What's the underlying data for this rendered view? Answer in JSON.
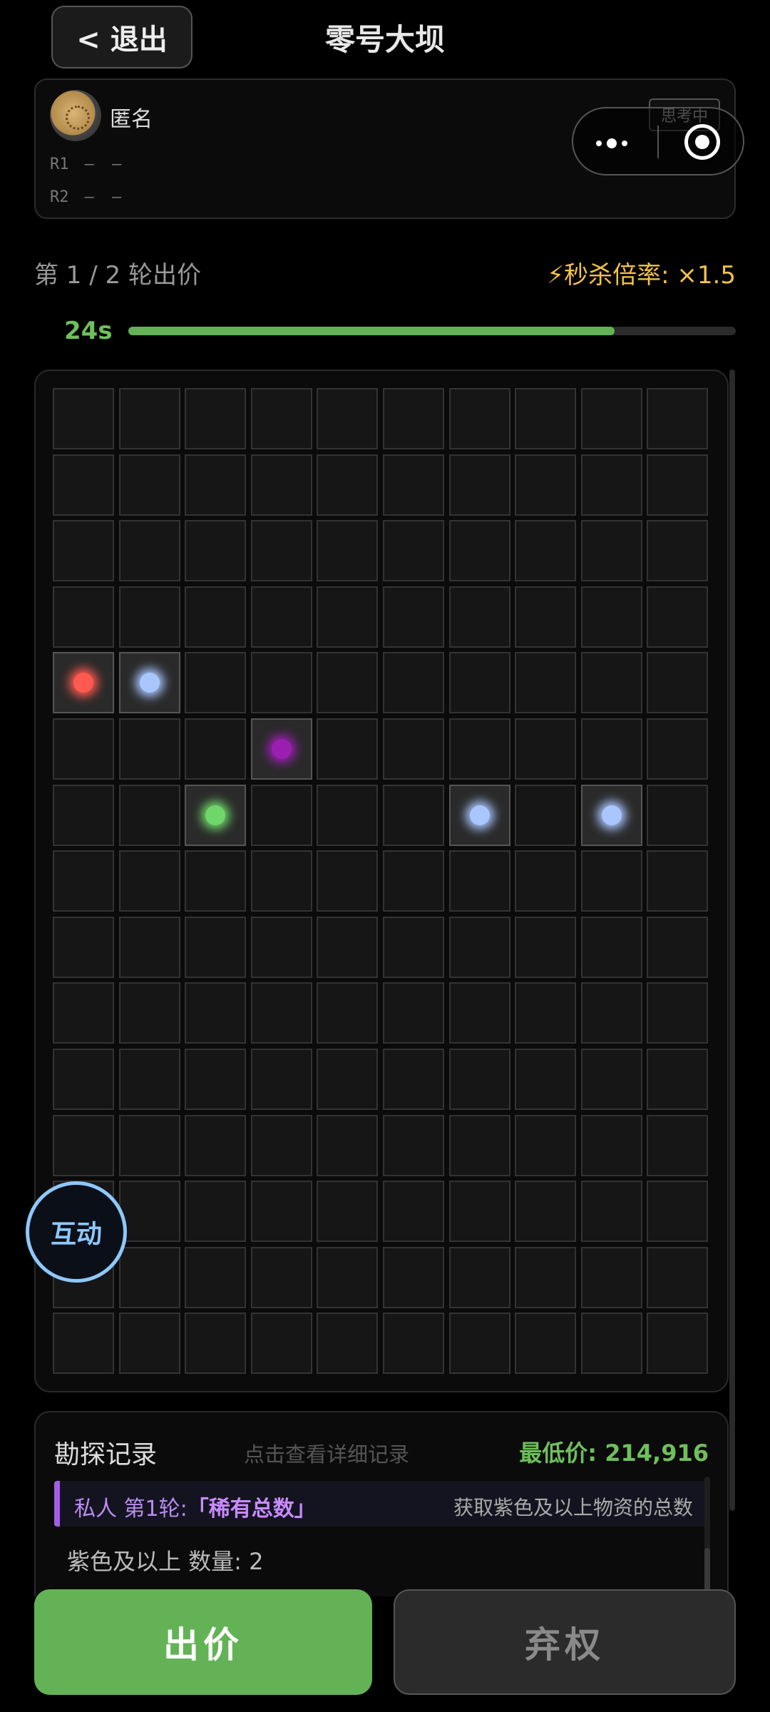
{
  "header": {
    "exit_label": "< 退出",
    "title": "零号大坝"
  },
  "player": {
    "name": "匿名",
    "rounds": [
      {
        "label": "R1",
        "value": "— —"
      },
      {
        "label": "R2",
        "value": "— —"
      }
    ]
  },
  "miniprogram": {
    "status": "思考中",
    "menu_icon": "more-dots-icon",
    "close_icon": "target-icon"
  },
  "status": {
    "round_info": "第 1 / 2 轮出价",
    "multiplier": "⚡秒杀倍率: ×1.5",
    "timer": "24s",
    "timer_progress": 0.8
  },
  "grid": {
    "cols": 10,
    "rows": 15,
    "items": [
      {
        "row": 4,
        "col": 0,
        "color": "#ff5a4f"
      },
      {
        "row": 4,
        "col": 1,
        "color": "#a9c6ff"
      },
      {
        "row": 5,
        "col": 3,
        "color": "#9a1fb0"
      },
      {
        "row": 6,
        "col": 2,
        "color": "#6fd66a"
      },
      {
        "row": 6,
        "col": 6,
        "color": "#a9c6ff"
      },
      {
        "row": 6,
        "col": 8,
        "color": "#a9c6ff"
      }
    ]
  },
  "interact": {
    "label": "互动"
  },
  "record": {
    "title": "勘探记录",
    "hint": "点击查看详细记录",
    "min_price": "最低价: 214,916",
    "entry": {
      "who": "私人",
      "round": "第1轮:",
      "kind": "「稀有总数」",
      "desc": "获取紫色及以上物资的总数"
    },
    "result": "紫色及以上 数量: 2"
  },
  "actions": {
    "bid_label": "出价",
    "abstain_label": "弃权"
  }
}
